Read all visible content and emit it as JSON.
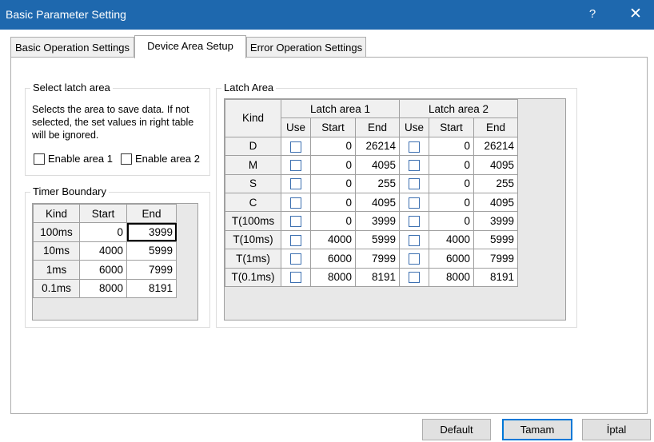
{
  "window": {
    "title": "Basic Parameter Setting",
    "help_glyph": "?",
    "close_glyph": "✕"
  },
  "tabs": [
    {
      "label": "Basic Operation Settings"
    },
    {
      "label": "Device Area Setup"
    },
    {
      "label": "Error Operation Settings"
    }
  ],
  "latch_select": {
    "title": "Select latch area",
    "description": "Selects the area to save data. If not selected, the set values in right table will be ignored.",
    "enable_area1": "Enable area 1",
    "enable_area2": "Enable area 2"
  },
  "timer_boundary": {
    "title": "Timer Boundary",
    "headers": [
      "Kind",
      "Start",
      "End"
    ],
    "rows": [
      {
        "kind": "100ms",
        "start": "0",
        "end": "3999"
      },
      {
        "kind": "10ms",
        "start": "4000",
        "end": "5999"
      },
      {
        "kind": "1ms",
        "start": "6000",
        "end": "7999"
      },
      {
        "kind": "0.1ms",
        "start": "8000",
        "end": "8191"
      }
    ]
  },
  "latch_area": {
    "title": "Latch Area",
    "kind_header": "Kind",
    "area1_header": "Latch area 1",
    "area2_header": "Latch area 2",
    "sub_headers": [
      "Use",
      "Start",
      "End",
      "Use",
      "Start",
      "End"
    ],
    "rows": [
      {
        "kind": "D",
        "a1_start": "0",
        "a1_end": "26214",
        "a2_start": "0",
        "a2_end": "26214"
      },
      {
        "kind": "M",
        "a1_start": "0",
        "a1_end": "4095",
        "a2_start": "0",
        "a2_end": "4095"
      },
      {
        "kind": "S",
        "a1_start": "0",
        "a1_end": "255",
        "a2_start": "0",
        "a2_end": "255"
      },
      {
        "kind": "C",
        "a1_start": "0",
        "a1_end": "4095",
        "a2_start": "0",
        "a2_end": "4095"
      },
      {
        "kind": "T(100ms",
        "a1_start": "0",
        "a1_end": "3999",
        "a2_start": "0",
        "a2_end": "3999"
      },
      {
        "kind": "T(10ms)",
        "a1_start": "4000",
        "a1_end": "5999",
        "a2_start": "4000",
        "a2_end": "5999"
      },
      {
        "kind": "T(1ms)",
        "a1_start": "6000",
        "a1_end": "7999",
        "a2_start": "6000",
        "a2_end": "7999"
      },
      {
        "kind": "T(0.1ms)",
        "a1_start": "8000",
        "a1_end": "8191",
        "a2_start": "8000",
        "a2_end": "8191"
      }
    ]
  },
  "buttons": {
    "default": "Default",
    "ok": "Tamam",
    "cancel": "İptal"
  }
}
